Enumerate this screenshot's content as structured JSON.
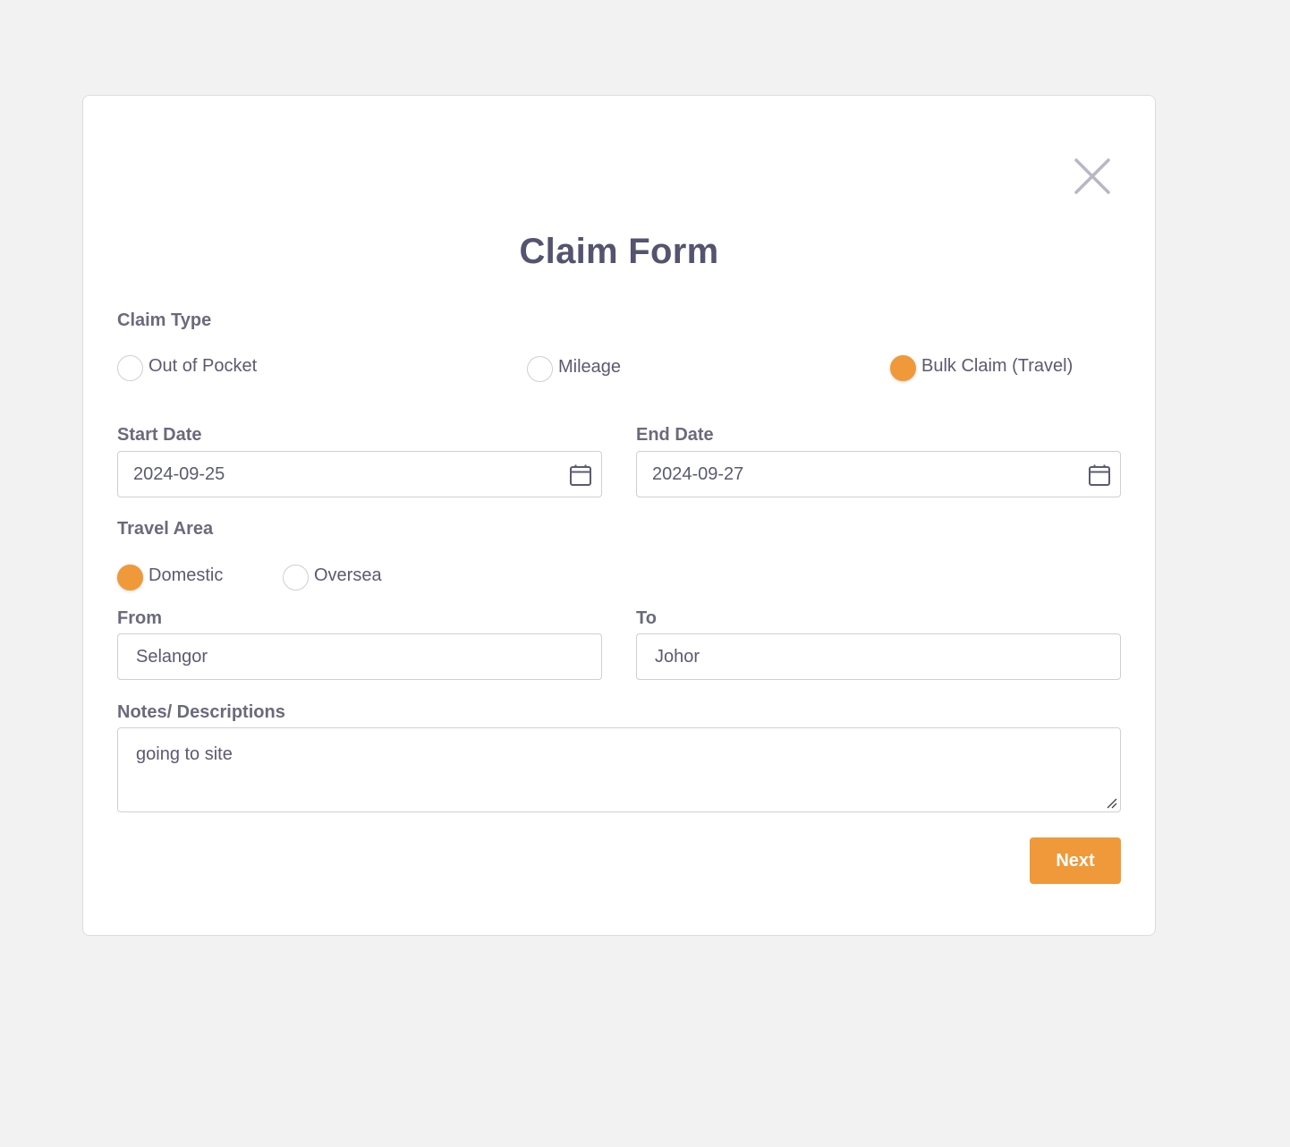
{
  "colors": {
    "accent": "#f0993a",
    "text": "#5b5a70",
    "border": "#cfcfd4"
  },
  "modal": {
    "close_icon": "close-icon",
    "title": "Claim Form"
  },
  "claim_type": {
    "label": "Claim Type",
    "options": [
      {
        "label": "Out of Pocket",
        "checked": false
      },
      {
        "label": "Mileage",
        "checked": false
      },
      {
        "label": "Bulk Claim (Travel)",
        "checked": true
      }
    ]
  },
  "start_date": {
    "label": "Start Date",
    "value": "2024-09-25",
    "icon": "calendar-icon"
  },
  "end_date": {
    "label": "End Date",
    "value": "2024-09-27",
    "icon": "calendar-icon"
  },
  "travel_area": {
    "label": "Travel Area",
    "options": [
      {
        "label": "Domestic",
        "checked": true
      },
      {
        "label": "Oversea",
        "checked": false
      }
    ]
  },
  "from": {
    "label": "From",
    "value": "Selangor"
  },
  "to": {
    "label": "To",
    "value": "Johor"
  },
  "notes": {
    "label": "Notes/ Descriptions",
    "value": "going to site"
  },
  "actions": {
    "next_label": "Next"
  }
}
